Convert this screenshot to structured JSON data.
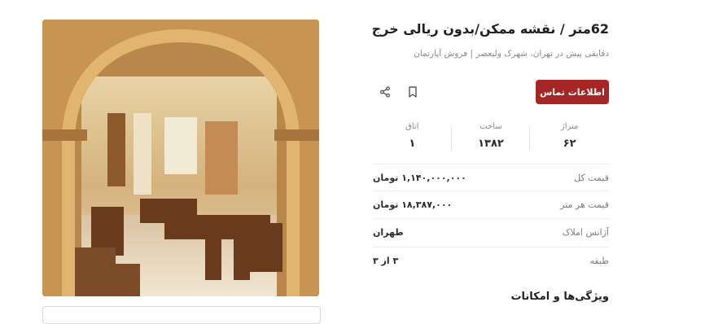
{
  "listing": {
    "title": "62متر / نقشه ممکن/بدون ریالی خرج",
    "subtitle": "دقایقی پیش در تهران، شهرک ولیعصر | فروش آپارتمان",
    "contact_label": "اطلاعات تماس",
    "icons": {
      "bookmark": "bookmark-icon",
      "share": "share-icon"
    }
  },
  "stats": [
    {
      "label": "متراژ",
      "value": "۶۲"
    },
    {
      "label": "ساخت",
      "value": "۱۳۸۲"
    },
    {
      "label": "اتاق",
      "value": "۱"
    }
  ],
  "details": [
    {
      "label": "قیمت کل",
      "value": "۱,۱۴۰,۰۰۰,۰۰۰ تومان"
    },
    {
      "label": "قیمت هر متر",
      "value": "۱۸,۳۸۷,۰۰۰ تومان"
    },
    {
      "label": "آژانس املاک",
      "value": "طهران"
    },
    {
      "label": "طبقه",
      "value": "۳ از ۳"
    }
  ],
  "features_heading": "ویژگی‌ها و امکانات",
  "colors": {
    "accent": "#a62626",
    "muted_text": "#8a8a8a",
    "divider": "#ececec"
  }
}
